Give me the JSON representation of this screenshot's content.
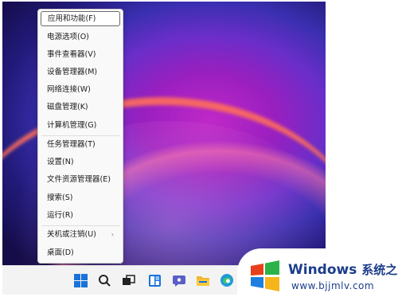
{
  "menu": {
    "items": [
      {
        "label": "应用和功能(F)"
      },
      {
        "label": "电源选项(O)"
      },
      {
        "label": "事件查看器(V)"
      },
      {
        "label": "设备管理器(M)"
      },
      {
        "label": "网络连接(W)"
      },
      {
        "label": "磁盘管理(K)"
      },
      {
        "label": "计算机管理(G)"
      },
      {
        "label": "任务管理器(T)"
      },
      {
        "label": "设置(N)"
      },
      {
        "label": "文件资源管理器(E)"
      },
      {
        "label": "搜索(S)"
      },
      {
        "label": "运行(R)"
      },
      {
        "label": "关机或注销(U)"
      },
      {
        "label": "桌面(D)"
      }
    ],
    "submenu_arrow": "›"
  },
  "taskbar": {
    "icons": [
      "windows-start-icon",
      "search-icon",
      "task-view-icon",
      "widgets-icon",
      "chat-icon",
      "file-explorer-icon",
      "edge-icon"
    ]
  },
  "watermark": {
    "title": "Windows",
    "title_cn": "系统之家",
    "url": "www.bjjmlv.com",
    "colors": {
      "red": "#e8401c",
      "green": "#2bb34a",
      "blue": "#1e7fe0",
      "yellow": "#f6b519"
    }
  }
}
